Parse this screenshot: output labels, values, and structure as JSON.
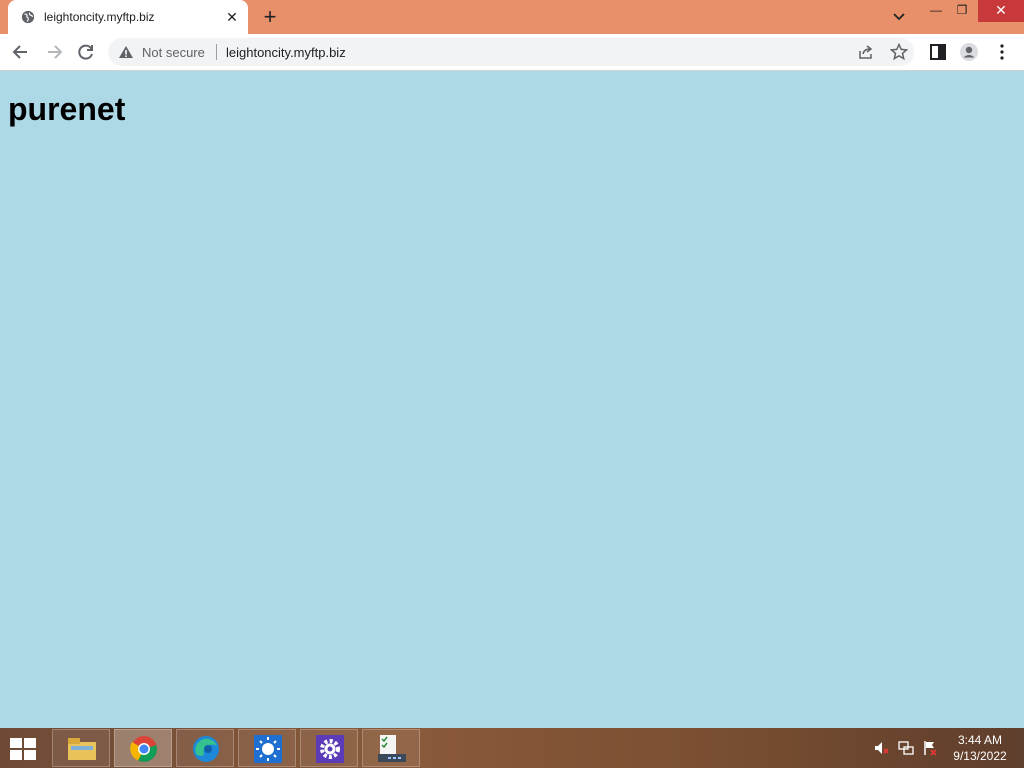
{
  "browser": {
    "tab": {
      "title": "leightoncity.myftp.biz",
      "favicon": "globe-icon",
      "close_icon": "close-icon"
    },
    "new_tab_icon": "plus-icon",
    "window_controls": {
      "minimize": "minimize-icon",
      "maximize": "restore-icon",
      "close": "close-icon"
    },
    "omnibox": {
      "security_label": "Not secure",
      "url": "leightoncity.myftp.biz"
    },
    "toolbar_icons": [
      "back-arrow-icon",
      "forward-arrow-icon",
      "reload-icon",
      "share-icon",
      "star-icon",
      "side-panel-icon",
      "profile-icon",
      "menu-icon"
    ]
  },
  "page": {
    "heading": "purenet",
    "background_color": "#add8e6"
  },
  "taskbar": {
    "apps": [
      "file-explorer-icon",
      "chrome-icon",
      "edge-icon",
      "brightness-app-icon",
      "settings-icon",
      "task-app-icon"
    ],
    "tray_icons": [
      "volume-muted-icon",
      "network-icon",
      "action-center-flag-icon"
    ],
    "clock": {
      "time": "3:44 AM",
      "date": "9/13/2022"
    }
  }
}
